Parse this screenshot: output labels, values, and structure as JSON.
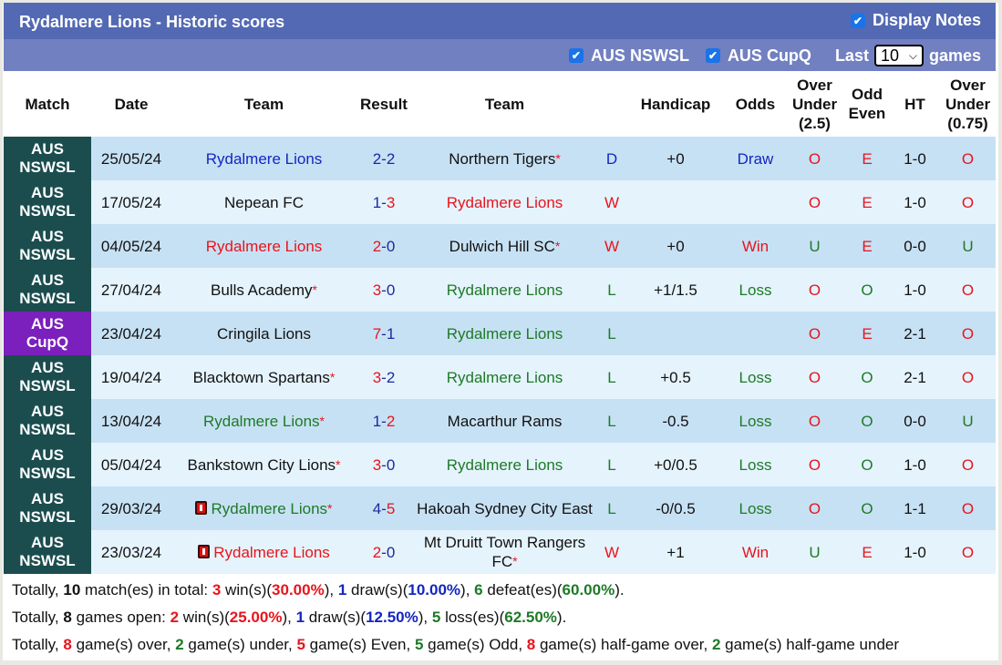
{
  "header": {
    "title": "Rydalmere Lions - Historic scores",
    "display_notes_label": "Display Notes",
    "display_notes_checked": true
  },
  "filters": {
    "league1_label": "AUS NSWSL",
    "league1_checked": true,
    "league2_label": "AUS CupQ",
    "league2_checked": true,
    "last_label": "Last",
    "games_count": "10",
    "games_label": "games"
  },
  "table": {
    "columns": [
      "Match",
      "Date",
      "Team",
      "Result",
      "Team",
      "",
      "Handicap",
      "Odds",
      "Over Under (2.5)",
      "Odd Even",
      "HT",
      "Over Under (0.75)"
    ],
    "col_over_under_25": [
      "Over",
      "Under",
      "(2.5)"
    ],
    "col_odd_even": [
      "Odd",
      "Even"
    ],
    "col_over_under_075": [
      "Over",
      "Under",
      "(0.75)"
    ],
    "rows": [
      {
        "league": [
          "AUS",
          "NSWSL"
        ],
        "league_type": "nswsl",
        "date": "25/05/24",
        "home": "Rydalmere Lions",
        "home_color": "blue",
        "home_star": false,
        "home_card": false,
        "score_home": "2",
        "score_away": "2",
        "score_home_color": "navy",
        "score_away_color": "navy",
        "away": "Northern Tigers",
        "away_color": "black",
        "away_star": true,
        "wl": "D",
        "wl_color": "blue",
        "handicap": "+0",
        "odds": "Draw",
        "odds_color": "blue",
        "ou": "O",
        "ou_color": "red",
        "oe": "E",
        "oe_color": "red",
        "ht": "1-0",
        "ou075": "O",
        "ou075_color": "red"
      },
      {
        "league": [
          "AUS",
          "NSWSL"
        ],
        "league_type": "nswsl",
        "date": "17/05/24",
        "home": "Nepean FC",
        "home_color": "black",
        "home_star": false,
        "home_card": false,
        "score_home": "1",
        "score_away": "3",
        "score_home_color": "navy",
        "score_away_color": "red",
        "away": "Rydalmere Lions",
        "away_color": "red",
        "away_star": false,
        "wl": "W",
        "wl_color": "red",
        "handicap": "",
        "odds": "",
        "odds_color": "black",
        "ou": "O",
        "ou_color": "red",
        "oe": "E",
        "oe_color": "red",
        "ht": "1-0",
        "ou075": "O",
        "ou075_color": "red"
      },
      {
        "league": [
          "AUS",
          "NSWSL"
        ],
        "league_type": "nswsl",
        "date": "04/05/24",
        "home": "Rydalmere Lions",
        "home_color": "red",
        "home_star": false,
        "home_card": false,
        "score_home": "2",
        "score_away": "0",
        "score_home_color": "red",
        "score_away_color": "navy",
        "away": "Dulwich Hill SC",
        "away_color": "black",
        "away_star": true,
        "wl": "W",
        "wl_color": "red",
        "handicap": "+0",
        "odds": "Win",
        "odds_color": "red",
        "ou": "U",
        "ou_color": "green",
        "oe": "E",
        "oe_color": "red",
        "ht": "0-0",
        "ou075": "U",
        "ou075_color": "green"
      },
      {
        "league": [
          "AUS",
          "NSWSL"
        ],
        "league_type": "nswsl",
        "date": "27/04/24",
        "home": "Bulls Academy",
        "home_color": "black",
        "home_star": true,
        "home_card": false,
        "score_home": "3",
        "score_away": "0",
        "score_home_color": "red",
        "score_away_color": "navy",
        "away": "Rydalmere Lions",
        "away_color": "green",
        "away_star": false,
        "wl": "L",
        "wl_color": "green",
        "handicap": "+1/1.5",
        "odds": "Loss",
        "odds_color": "green",
        "ou": "O",
        "ou_color": "red",
        "oe": "O",
        "oe_color": "green",
        "ht": "1-0",
        "ou075": "O",
        "ou075_color": "red"
      },
      {
        "league": [
          "AUS",
          "CupQ"
        ],
        "league_type": "cup",
        "date": "23/04/24",
        "home": "Cringila Lions",
        "home_color": "black",
        "home_star": false,
        "home_card": false,
        "score_home": "7",
        "score_away": "1",
        "score_home_color": "red",
        "score_away_color": "navy",
        "away": "Rydalmere Lions",
        "away_color": "green",
        "away_star": false,
        "wl": "L",
        "wl_color": "green",
        "handicap": "",
        "odds": "",
        "odds_color": "black",
        "ou": "O",
        "ou_color": "red",
        "oe": "E",
        "oe_color": "red",
        "ht": "2-1",
        "ou075": "O",
        "ou075_color": "red"
      },
      {
        "league": [
          "AUS",
          "NSWSL"
        ],
        "league_type": "nswsl",
        "date": "19/04/24",
        "home": "Blacktown Spartans",
        "home_color": "black",
        "home_star": true,
        "home_card": false,
        "score_home": "3",
        "score_away": "2",
        "score_home_color": "red",
        "score_away_color": "navy",
        "away": "Rydalmere Lions",
        "away_color": "green",
        "away_star": false,
        "wl": "L",
        "wl_color": "green",
        "handicap": "+0.5",
        "odds": "Loss",
        "odds_color": "green",
        "ou": "O",
        "ou_color": "red",
        "oe": "O",
        "oe_color": "green",
        "ht": "2-1",
        "ou075": "O",
        "ou075_color": "red"
      },
      {
        "league": [
          "AUS",
          "NSWSL"
        ],
        "league_type": "nswsl",
        "date": "13/04/24",
        "home": "Rydalmere Lions",
        "home_color": "green",
        "home_star": true,
        "home_card": false,
        "score_home": "1",
        "score_away": "2",
        "score_home_color": "navy",
        "score_away_color": "red",
        "away": "Macarthur Rams",
        "away_color": "black",
        "away_star": false,
        "wl": "L",
        "wl_color": "green",
        "handicap": "-0.5",
        "odds": "Loss",
        "odds_color": "green",
        "ou": "O",
        "ou_color": "red",
        "oe": "O",
        "oe_color": "green",
        "ht": "0-0",
        "ou075": "U",
        "ou075_color": "green"
      },
      {
        "league": [
          "AUS",
          "NSWSL"
        ],
        "league_type": "nswsl",
        "date": "05/04/24",
        "home": "Bankstown City Lions",
        "home_color": "black",
        "home_star": true,
        "home_card": false,
        "score_home": "3",
        "score_away": "0",
        "score_home_color": "red",
        "score_away_color": "navy",
        "away": "Rydalmere Lions",
        "away_color": "green",
        "away_star": false,
        "wl": "L",
        "wl_color": "green",
        "handicap": "+0/0.5",
        "odds": "Loss",
        "odds_color": "green",
        "ou": "O",
        "ou_color": "red",
        "oe": "O",
        "oe_color": "green",
        "ht": "1-0",
        "ou075": "O",
        "ou075_color": "red"
      },
      {
        "league": [
          "AUS",
          "NSWSL"
        ],
        "league_type": "nswsl",
        "date": "29/03/24",
        "home": "Rydalmere Lions",
        "home_color": "green",
        "home_star": true,
        "home_card": true,
        "score_home": "4",
        "score_away": "5",
        "score_home_color": "navy",
        "score_away_color": "red",
        "away": "Hakoah Sydney City East",
        "away_color": "black",
        "away_star": false,
        "wl": "L",
        "wl_color": "green",
        "handicap": "-0/0.5",
        "odds": "Loss",
        "odds_color": "green",
        "ou": "O",
        "ou_color": "red",
        "oe": "O",
        "oe_color": "green",
        "ht": "1-1",
        "ou075": "O",
        "ou075_color": "red"
      },
      {
        "league": [
          "AUS",
          "NSWSL"
        ],
        "league_type": "nswsl",
        "date": "23/03/24",
        "home": "Rydalmere Lions",
        "home_color": "red",
        "home_star": false,
        "home_card": true,
        "score_home": "2",
        "score_away": "0",
        "score_home_color": "red",
        "score_away_color": "navy",
        "away": "Mt Druitt Town Rangers FC",
        "away_color": "black",
        "away_star": true,
        "wl": "W",
        "wl_color": "red",
        "handicap": "+1",
        "odds": "Win",
        "odds_color": "red",
        "ou": "U",
        "ou_color": "green",
        "oe": "E",
        "oe_color": "red",
        "ht": "1-0",
        "ou075": "O",
        "ou075_color": "red"
      }
    ]
  },
  "summary": {
    "line1": [
      {
        "t": "Totally, ",
        "c": "black",
        "b": false
      },
      {
        "t": "10",
        "c": "black",
        "b": true
      },
      {
        "t": " match(es) in total: ",
        "c": "black",
        "b": false
      },
      {
        "t": "3",
        "c": "red",
        "b": true
      },
      {
        "t": " win(s)(",
        "c": "black",
        "b": false
      },
      {
        "t": "30.00%",
        "c": "red",
        "b": true
      },
      {
        "t": "), ",
        "c": "black",
        "b": false
      },
      {
        "t": "1",
        "c": "blue",
        "b": true
      },
      {
        "t": " draw(s)(",
        "c": "black",
        "b": false
      },
      {
        "t": "10.00%",
        "c": "blue",
        "b": true
      },
      {
        "t": "), ",
        "c": "black",
        "b": false
      },
      {
        "t": "6",
        "c": "green",
        "b": true
      },
      {
        "t": " defeat(es)(",
        "c": "black",
        "b": false
      },
      {
        "t": "60.00%",
        "c": "green",
        "b": true
      },
      {
        "t": ").",
        "c": "black",
        "b": false
      }
    ],
    "line2": [
      {
        "t": "Totally, ",
        "c": "black",
        "b": false
      },
      {
        "t": "8",
        "c": "black",
        "b": true
      },
      {
        "t": " games open: ",
        "c": "black",
        "b": false
      },
      {
        "t": "2",
        "c": "red",
        "b": true
      },
      {
        "t": " win(s)(",
        "c": "black",
        "b": false
      },
      {
        "t": "25.00%",
        "c": "red",
        "b": true
      },
      {
        "t": "), ",
        "c": "black",
        "b": false
      },
      {
        "t": "1",
        "c": "blue",
        "b": true
      },
      {
        "t": " draw(s)(",
        "c": "black",
        "b": false
      },
      {
        "t": "12.50%",
        "c": "blue",
        "b": true
      },
      {
        "t": "), ",
        "c": "black",
        "b": false
      },
      {
        "t": "5",
        "c": "green",
        "b": true
      },
      {
        "t": " loss(es)(",
        "c": "black",
        "b": false
      },
      {
        "t": "62.50%",
        "c": "green",
        "b": true
      },
      {
        "t": ").",
        "c": "black",
        "b": false
      }
    ],
    "line3": [
      {
        "t": "Totally, ",
        "c": "black",
        "b": false
      },
      {
        "t": "8",
        "c": "red",
        "b": true
      },
      {
        "t": " game(s) over, ",
        "c": "black",
        "b": false
      },
      {
        "t": "2",
        "c": "green",
        "b": true
      },
      {
        "t": " game(s) under, ",
        "c": "black",
        "b": false
      },
      {
        "t": "5",
        "c": "red",
        "b": true
      },
      {
        "t": " game(s) Even, ",
        "c": "black",
        "b": false
      },
      {
        "t": "5",
        "c": "green",
        "b": true
      },
      {
        "t": " game(s) Odd, ",
        "c": "black",
        "b": false
      },
      {
        "t": "8",
        "c": "red",
        "b": true
      },
      {
        "t": " game(s) half-game over, ",
        "c": "black",
        "b": false
      },
      {
        "t": "2",
        "c": "green",
        "b": true
      },
      {
        "t": " game(s) half-game under",
        "c": "black",
        "b": false
      }
    ]
  }
}
